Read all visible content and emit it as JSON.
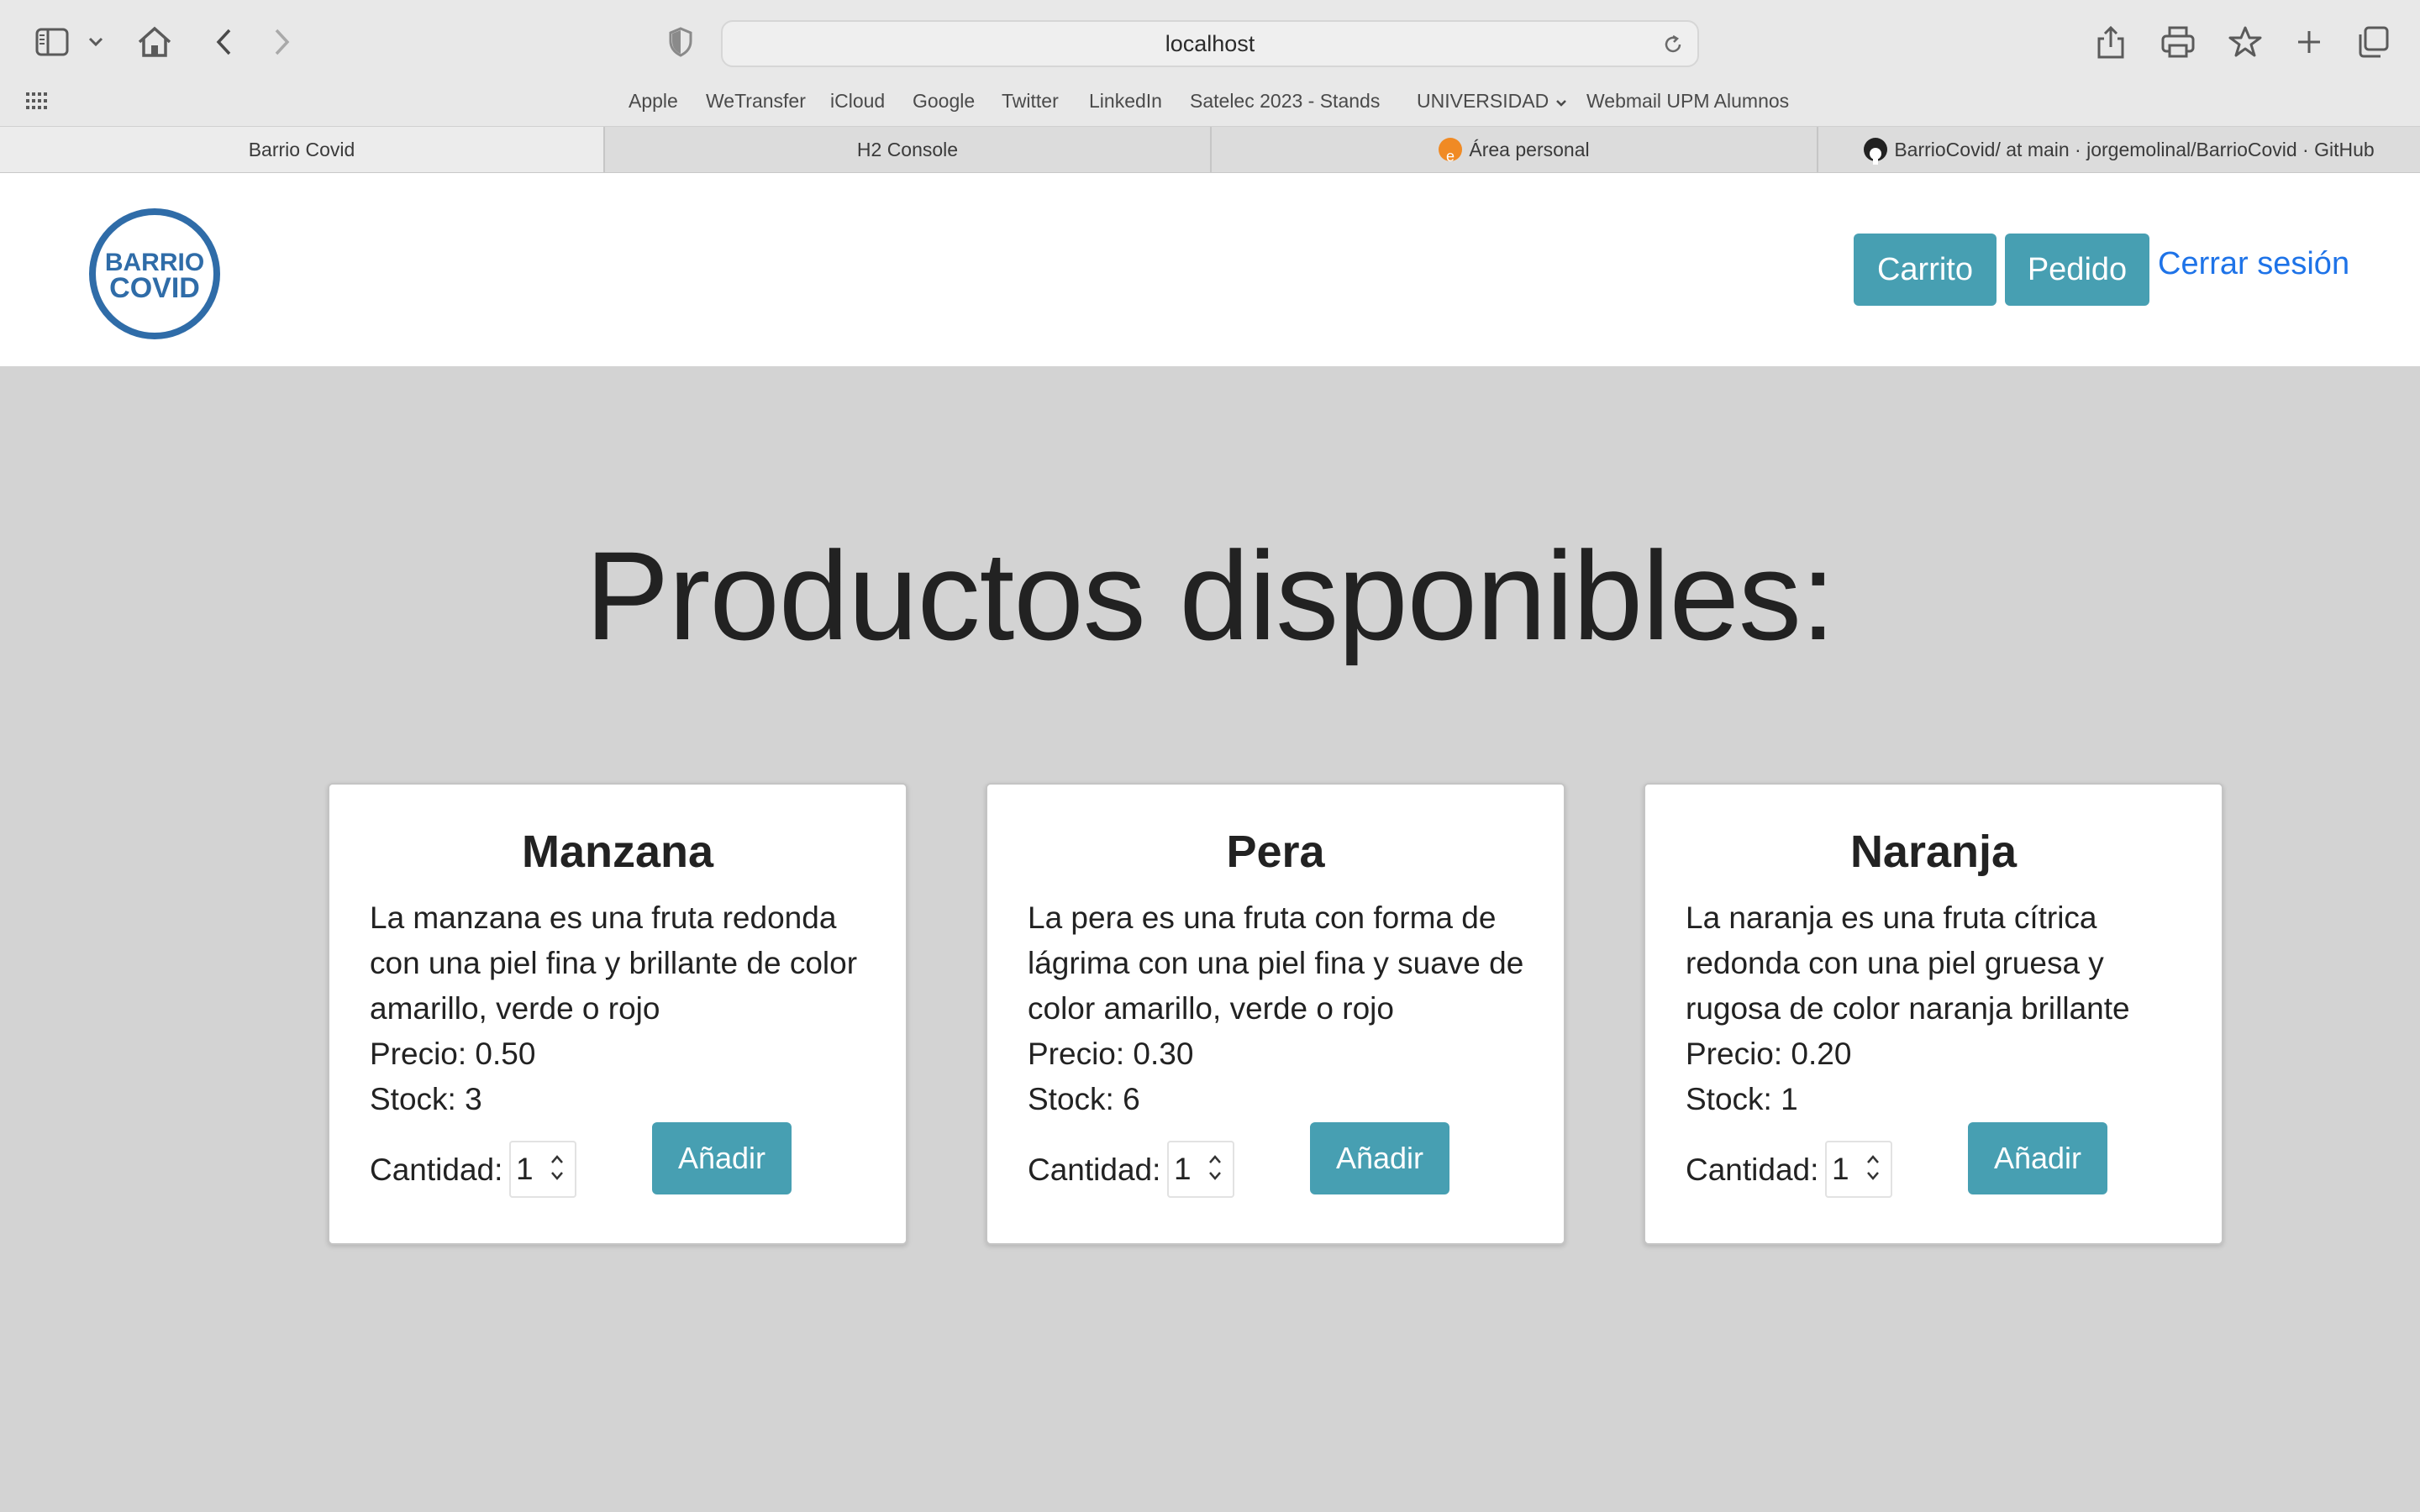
{
  "browser": {
    "url": "localhost",
    "favorites": [
      "Apple",
      "WeTransfer",
      "iCloud",
      "Google",
      "Twitter",
      "LinkedIn",
      "Satelec 2023 - Stands",
      "UNIVERSIDAD",
      "Webmail UPM Alumnos"
    ],
    "tabs": [
      {
        "label": "Barrio Covid",
        "active": true
      },
      {
        "label": "H2 Console",
        "active": false
      },
      {
        "label": "Área personal",
        "active": false
      },
      {
        "label": "BarrioCovid/ at main · jorgemolinal/BarrioCovid · GitHub",
        "active": false
      }
    ]
  },
  "navbar": {
    "logo_top": "BARRIO",
    "logo_bottom": "COVID",
    "cart_label": "Carrito",
    "order_label": "Pedido",
    "logout_label": "Cerrar sesión"
  },
  "main": {
    "heading": "Productos disponibles:",
    "products": [
      {
        "name": "Manzana",
        "description": "La manzana es una fruta redonda con una piel fina y brillante de color amarillo, verde o rojo",
        "price": "Precio: 0.50",
        "stock": "Stock: 3",
        "qty_label": "Cantidad:",
        "qty_value": "1",
        "add_label": "Añadir"
      },
      {
        "name": "Pera",
        "description": "La pera es una fruta con forma de lágrima con una piel fina y suave de color amarillo, verde o rojo",
        "price": "Precio: 0.30",
        "stock": "Stock: 6",
        "qty_label": "Cantidad:",
        "qty_value": "1",
        "add_label": "Añadir"
      },
      {
        "name": "Naranja",
        "description": "La naranja es una fruta cítrica redonda con una piel gruesa y rugosa de color naranja brillante",
        "price": "Precio: 0.20",
        "stock": "Stock: 1",
        "qty_label": "Cantidad:",
        "qty_value": "1",
        "add_label": "Añadir"
      }
    ]
  },
  "colors": {
    "accent": "#479fb2",
    "link": "#1e73e8",
    "logo": "#2f6ca8",
    "page_bg": "#d3d3d3"
  }
}
